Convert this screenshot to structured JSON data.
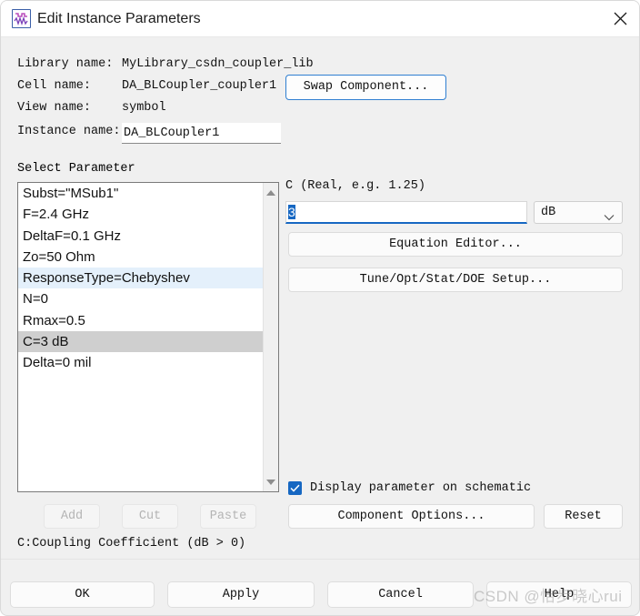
{
  "window": {
    "title": "Edit Instance Parameters",
    "icon": "schematic-waveform-icon",
    "close_icon": "close-icon"
  },
  "header": {
    "library_name_label": "Library name:",
    "library_name_value": "MyLibrary_csdn_coupler_lib",
    "cell_name_label": "Cell name:",
    "cell_name_value": "DA_BLCoupler_coupler1",
    "view_name_label": "View name:",
    "view_name_value": "symbol",
    "instance_name_label": "Instance name:",
    "instance_name_value": "DA_BLCoupler1",
    "swap_component_label": "Swap Component..."
  },
  "parameter_panel": {
    "title": "Select Parameter",
    "items": [
      {
        "text": "Subst=\"MSub1\"",
        "state": "normal"
      },
      {
        "text": "F=2.4 GHz",
        "state": "normal"
      },
      {
        "text": "DeltaF=0.1 GHz",
        "state": "normal"
      },
      {
        "text": "Zo=50 Ohm",
        "state": "normal"
      },
      {
        "text": "ResponseType=Chebyshev",
        "state": "hovered"
      },
      {
        "text": "N=0",
        "state": "normal"
      },
      {
        "text": "Rmax=0.5",
        "state": "normal"
      },
      {
        "text": "C=3 dB",
        "state": "selected"
      },
      {
        "text": "Delta=0 mil",
        "state": "normal"
      }
    ],
    "scroll_up_icon": "scroll-up-arrow-icon",
    "scroll_down_icon": "scroll-down-arrow-icon",
    "add_label": "Add",
    "cut_label": "Cut",
    "paste_label": "Paste",
    "description": "C:Coupling Coefficient (dB > 0)"
  },
  "value_panel": {
    "caption": "C (Real, e.g. 1.25)",
    "value": "3",
    "unit": "dB",
    "unit_chevron_icon": "chevron-down-icon",
    "equation_editor_label": "Equation Editor...",
    "tune_setup_label": "Tune/Opt/Stat/DOE Setup...",
    "display_parameter_label": "Display parameter on schematic",
    "display_parameter_checked": true,
    "check_icon": "check-icon",
    "component_options_label": "Component Options...",
    "reset_label": "Reset"
  },
  "footer": {
    "ok_label": "OK",
    "apply_label": "Apply",
    "cancel_label": "Cancel",
    "help_label": "Help"
  },
  "watermark": {
    "text": "CSDN @怡步晓心rui"
  },
  "colors": {
    "accent": "#1667c2",
    "focus_border": "#2f7fd1",
    "selected_row": "#cfcfcf",
    "hovered_row": "#e4f0fb",
    "window_bg": "#f0f0f0",
    "disabled_text": "#b4b4b4"
  }
}
